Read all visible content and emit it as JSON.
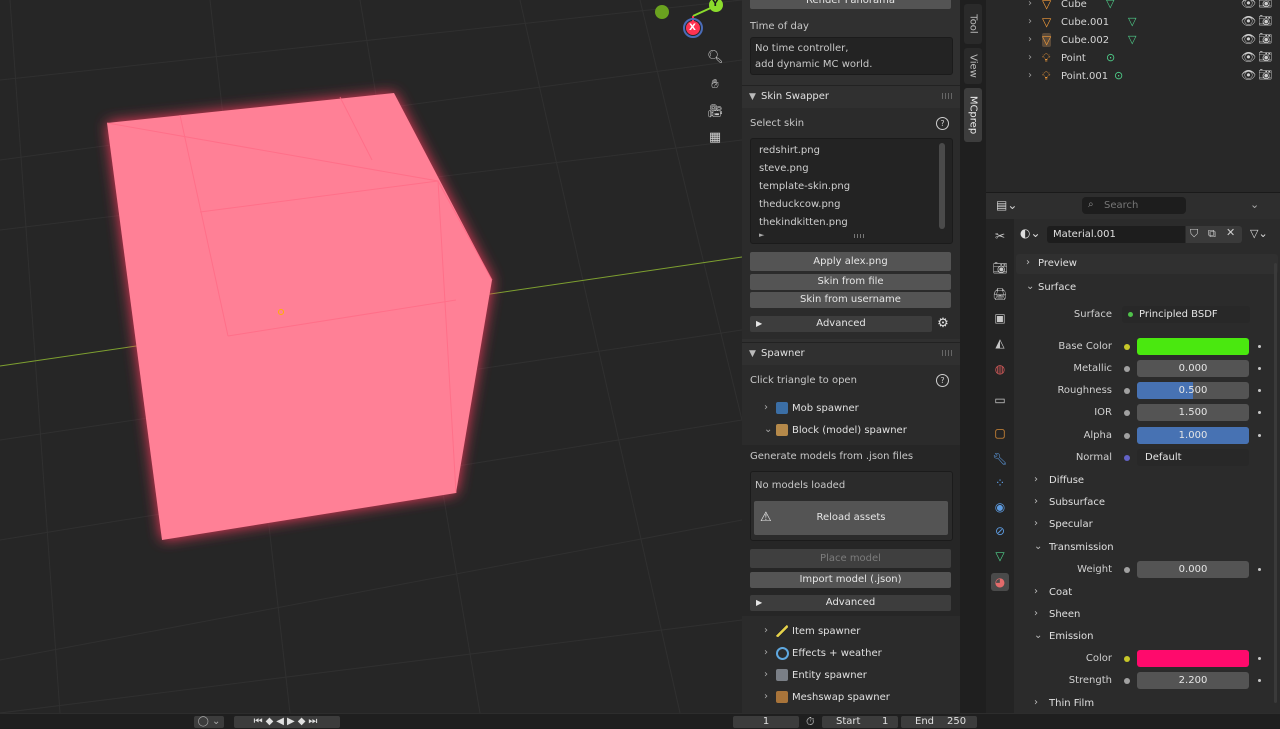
{
  "viewport": {
    "gizmo_labels": {
      "y": "Y",
      "x": "X"
    }
  },
  "npanel": {
    "render_panorama_label": "Render Panorama",
    "time_of_day": {
      "label": "Time of day",
      "message_line1": "No time controller,",
      "message_line2": "add dynamic MC world."
    },
    "skin_swapper": {
      "title": "Skin Swapper",
      "select_label": "Select skin",
      "skins": [
        "redshirt.png",
        "steve.png",
        "template-skin.png",
        "theduckcow.png",
        "thekindkitten.png"
      ],
      "apply_label": "Apply alex.png",
      "skin_from_file_label": "Skin from file",
      "skin_from_username_label": "Skin from username",
      "advanced_label": "Advanced"
    },
    "spawner": {
      "title": "Spawner",
      "hint": "Click triangle to open",
      "mob_spawner": "Mob spawner",
      "block_spawner": "Block (model) spawner",
      "generate_label": "Generate models from .json files",
      "no_models": "No models loaded",
      "reload_assets": "Reload assets",
      "place_model": "Place model",
      "import_model": "Import model (.json)",
      "advanced_label": "Advanced",
      "item_spawner": "Item spawner",
      "effects_weather": "Effects + weather",
      "entity_spawner": "Entity spawner",
      "meshswap_spawner": "Meshswap spawner"
    }
  },
  "side_tabs": [
    "Tool",
    "View",
    "MCprep"
  ],
  "outliner": {
    "rows": [
      {
        "name": "Cube"
      },
      {
        "name": "Cube.001"
      },
      {
        "name": "Cube.002"
      },
      {
        "name": "Point"
      },
      {
        "name": "Point.001"
      }
    ]
  },
  "properties": {
    "search_placeholder": "Search",
    "material_name": "Material.001",
    "preview_label": "Preview",
    "surface_section": "Surface",
    "surface_label": "Surface",
    "surface_value": "Principled BSDF",
    "fields": {
      "base_color": {
        "label": "Base Color",
        "color": "#4ae80f"
      },
      "metallic": {
        "label": "Metallic",
        "value": "0.000"
      },
      "roughness": {
        "label": "Roughness",
        "value": "0.500",
        "fraction": 0.5
      },
      "ior": {
        "label": "IOR",
        "value": "1.500"
      },
      "alpha": {
        "label": "Alpha",
        "value": "1.000",
        "fraction": 1.0
      },
      "normal": {
        "label": "Normal",
        "value": "Default"
      }
    },
    "subsections": {
      "diffuse": "Diffuse",
      "subsurface": "Subsurface",
      "specular": "Specular",
      "transmission": "Transmission",
      "weight_label": "Weight",
      "weight_value": "0.000",
      "coat": "Coat",
      "sheen": "Sheen",
      "emission": "Emission",
      "emission_color_label": "Color",
      "emission_color": "#ff0a6c",
      "strength_label": "Strength",
      "strength_value": "2.200",
      "thin_film": "Thin Film"
    }
  },
  "timeline": {
    "current_frame": "1",
    "start_label": "Start",
    "start_value": "1",
    "end_label": "End",
    "end_value": "250"
  },
  "colors": {
    "accent_blue": "#4772b3",
    "cube_emission": "#ff7f95"
  }
}
